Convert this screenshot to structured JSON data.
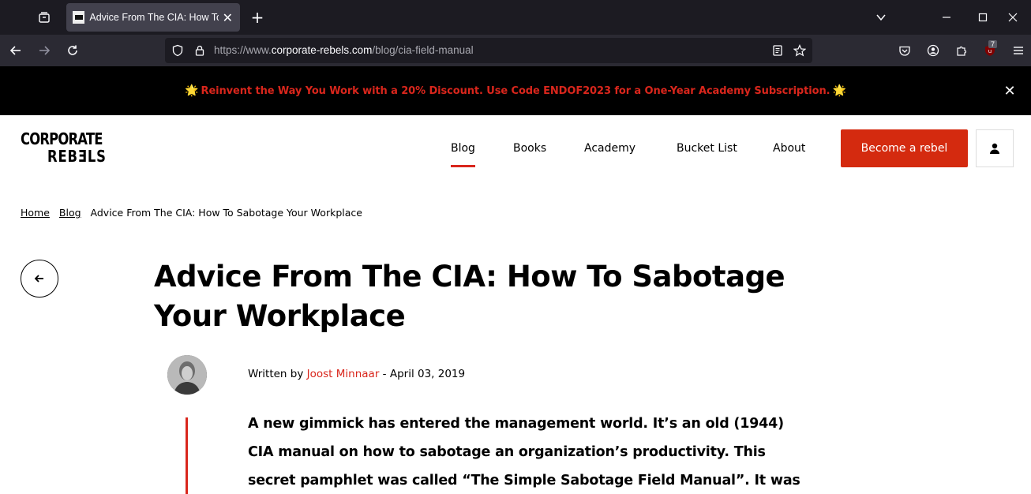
{
  "browser": {
    "tab_title": "Advice From The CIA: How To Sabotage Your Workplace",
    "url_prefix": "https://www.",
    "url_host": "corporate-rebels.com",
    "url_path": "/blog/cia-field-manual",
    "extension_badge": "7"
  },
  "promo": {
    "text": "Reinvent the Way You Work with a 20% Discount. Use Code ENDOF2023 for a One-Year Academy Subscription.",
    "emoji": "🌟",
    "close": "✕"
  },
  "logo": {
    "line1": "CORPORATE",
    "line2": "REBƎLS"
  },
  "nav": {
    "items": [
      {
        "label": "Blog"
      },
      {
        "label": "Books"
      },
      {
        "label": "Academy"
      },
      {
        "label": "Bucket List"
      },
      {
        "label": "About"
      }
    ],
    "cta": "Become a rebel"
  },
  "breadcrumb": {
    "home": "Home",
    "blog": "Blog",
    "current": "Advice From The CIA: How To Sabotage Your Workplace"
  },
  "article": {
    "title": "Advice From The CIA: How To Sabotage Your Workplace",
    "written_by": "Written by ",
    "author": "Joost Minnaar",
    "separator": " - ",
    "date": "April 03, 2019",
    "intro": "A new gimmick has entered the management world. It’s an old (1944) CIA manual on how to sabotage an organization’s productivity. This secret pamphlet was called “The Simple Sabotage Field Manual”. It was"
  },
  "colors": {
    "accent": "#d9261c",
    "promo_bg": "#000000"
  }
}
